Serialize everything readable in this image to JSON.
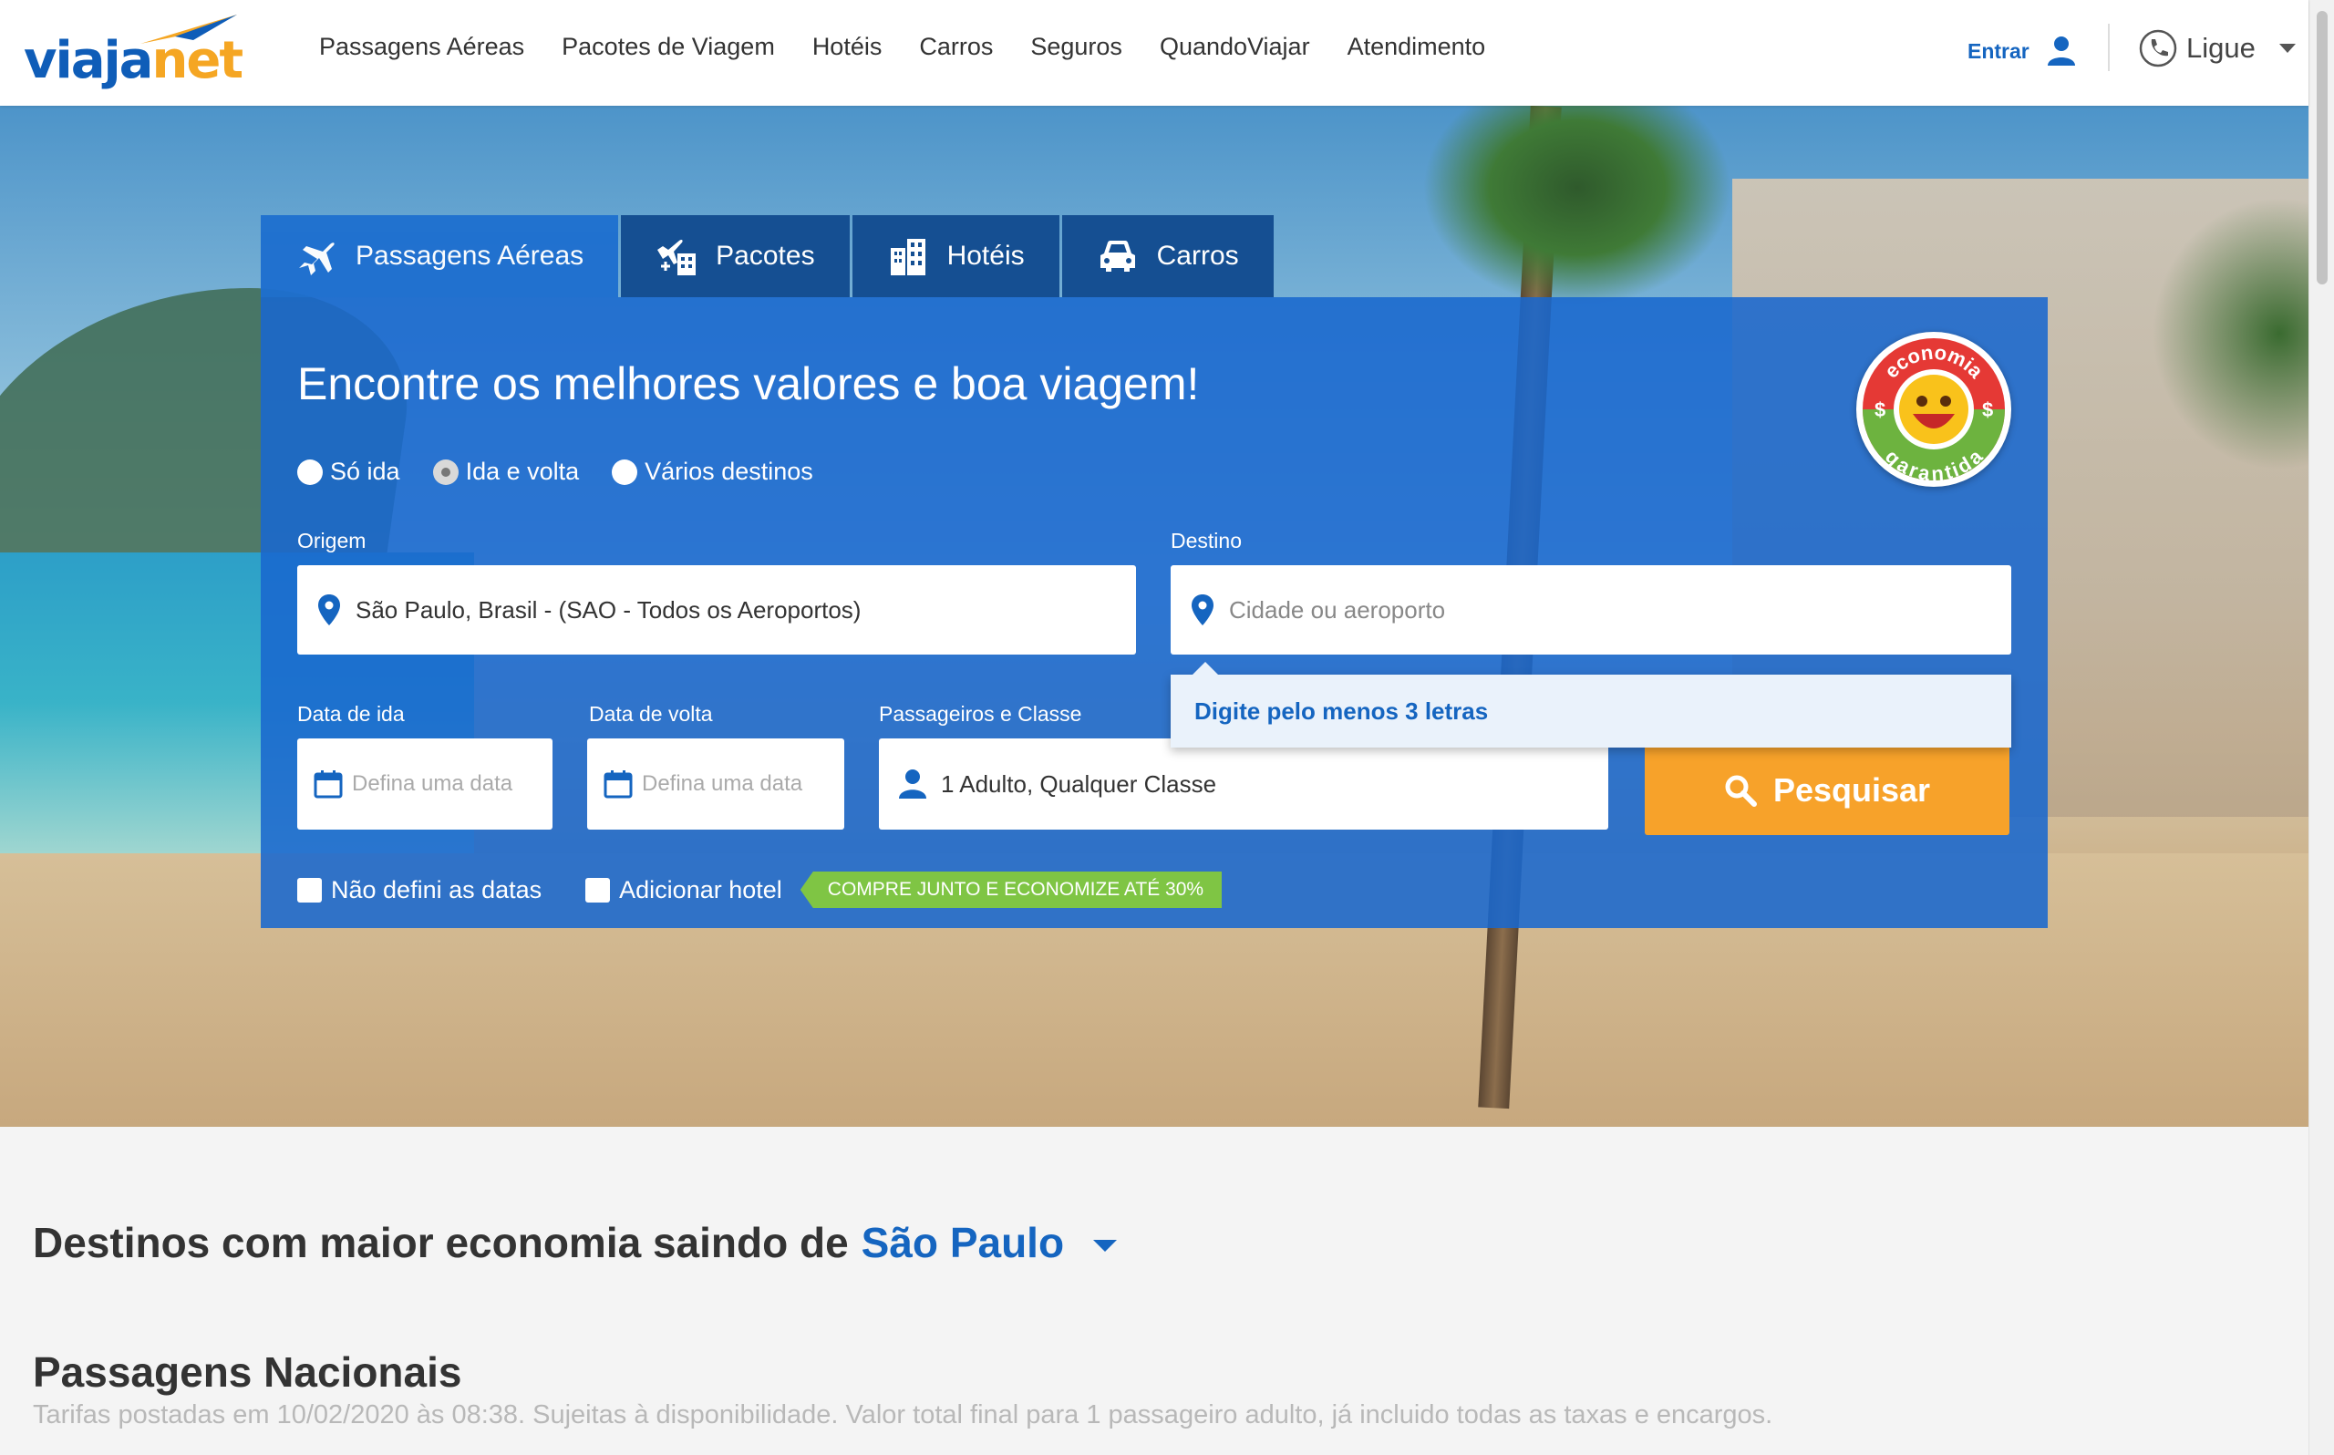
{
  "header": {
    "logo": {
      "part1": "viaja",
      "part2": "net"
    },
    "nav": [
      "Passagens Aéreas",
      "Pacotes de Viagem",
      "Hotéis",
      "Carros",
      "Seguros",
      "QuandoViajar",
      "Atendimento"
    ],
    "login_label": "Entrar",
    "phone_label": "Ligue"
  },
  "search": {
    "tabs": [
      {
        "label": "Passagens Aéreas",
        "icon": "airplane-icon",
        "active": true
      },
      {
        "label": "Pacotes",
        "icon": "package-icon",
        "active": false
      },
      {
        "label": "Hotéis",
        "icon": "hotel-icon",
        "active": false
      },
      {
        "label": "Carros",
        "icon": "car-icon",
        "active": false
      }
    ],
    "title": "Encontre os melhores valores e boa viagem!",
    "trip_types": [
      {
        "label": "Só ida",
        "checked": false
      },
      {
        "label": "Ida e volta",
        "checked": true
      },
      {
        "label": "Vários destinos",
        "checked": false
      }
    ],
    "origin": {
      "label": "Origem",
      "value": "São Paulo, Brasil - (SAO - Todos os Aeroportos)"
    },
    "destination": {
      "label": "Destino",
      "placeholder": "Cidade ou aeroporto",
      "hint": "Digite pelo menos 3 letras"
    },
    "departure": {
      "label": "Data de ida",
      "placeholder": "Defina uma data"
    },
    "return": {
      "label": "Data de volta",
      "placeholder": "Defina uma data"
    },
    "passengers": {
      "label": "Passageiros e Classe",
      "value": "1 Adulto, Qualquer Classe"
    },
    "search_button": "Pesquisar",
    "no_dates_label": "Não defini as datas",
    "add_hotel_label": "Adicionar hotel",
    "promo": "COMPRE JUNTO E ECONOMIZE ATÉ 30%",
    "badge": {
      "top": "economia",
      "bottom": "garantida"
    }
  },
  "destinations": {
    "title_prefix": "Destinos com maior economia saindo de",
    "city": "São Paulo",
    "national_title": "Passagens Nacionais",
    "disclaimer": "Tarifas postadas em 10/02/2020 às 08:38. Sujeitas à disponibilidade. Valor total final para 1 passageiro adulto, já incluido todas as taxas e encargos."
  },
  "colors": {
    "brand_blue": "#1565c0",
    "panel_blue": "#1968ce",
    "tab_dark": "#154f92",
    "search_orange": "#f7a22a",
    "promo_green": "#7fc544"
  }
}
